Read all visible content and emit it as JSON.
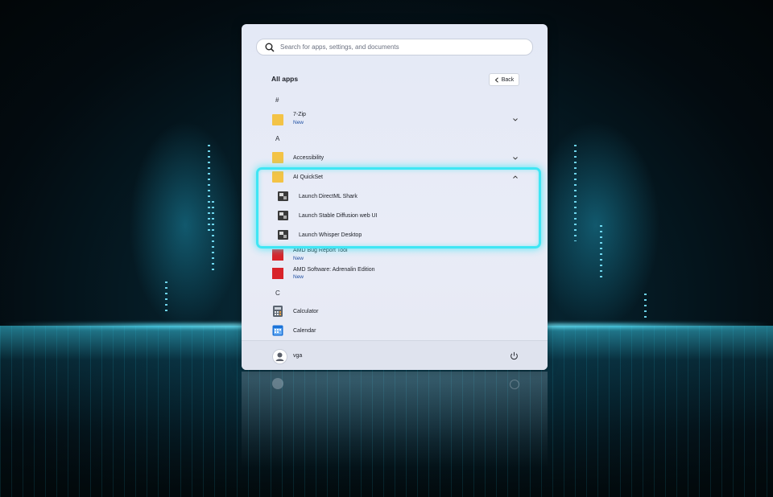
{
  "search": {
    "placeholder": "Search for apps, settings, and documents"
  },
  "header": {
    "title": "All apps",
    "back_label": "Back"
  },
  "groups": [
    {
      "letter": "#"
    },
    {
      "letter": "A"
    },
    {
      "letter": "C"
    }
  ],
  "apps": {
    "seven_zip": {
      "name": "7-Zip",
      "badge": "New"
    },
    "accessibility": {
      "name": "Accessibility"
    },
    "ai_quickset": {
      "name": "AI QuickSet",
      "children": [
        {
          "name": "Launch DirectML Shark"
        },
        {
          "name": "Launch Stable Diffusion web UI"
        },
        {
          "name": "Launch Whisper Desktop"
        }
      ]
    },
    "amd_bug": {
      "name": "AMD Bug Report Tool",
      "badge": "New"
    },
    "amd_software": {
      "name": "AMD Software: Adrenalin Edition",
      "badge": "New"
    },
    "calculator": {
      "name": "Calculator"
    },
    "calendar": {
      "name": "Calendar"
    }
  },
  "footer": {
    "user_name": "vga"
  },
  "colors": {
    "highlight": "#3fe6f4",
    "badge": "#1f4fa3",
    "folder": "#f3c346",
    "amd": "#d8232a"
  },
  "icons": [
    "search-icon",
    "chevron-left-icon",
    "folder-icon",
    "chevron-down-icon",
    "chevron-up-icon",
    "app-icon",
    "amd-icon",
    "calculator-icon",
    "calendar-icon",
    "user-icon",
    "power-icon"
  ]
}
